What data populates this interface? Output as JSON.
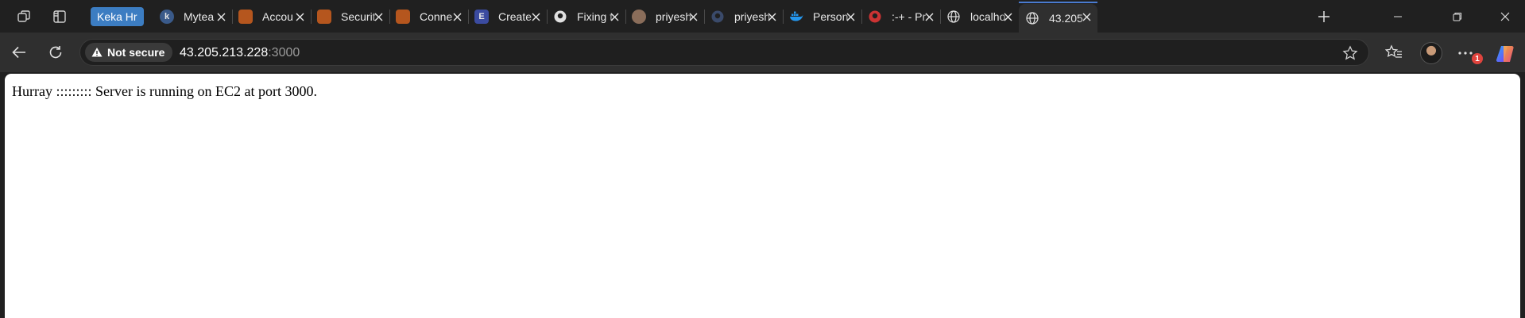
{
  "browser": {
    "tab_group_label": "Keka Hr",
    "tabs": [
      {
        "title": "Mytea",
        "icon": "keka-k-icon",
        "color": "#3a5a8a"
      },
      {
        "title": "Accou",
        "icon": "aws-cube-icon",
        "color": "#b5561e"
      },
      {
        "title": "Securit",
        "icon": "aws-ec2-icon",
        "color": "#b5561e"
      },
      {
        "title": "Conne",
        "icon": "aws-ec2-icon",
        "color": "#b5561e"
      },
      {
        "title": "Create",
        "icon": "doc-icon",
        "color": "#3b4ba0"
      },
      {
        "title": "Fixing t",
        "icon": "github-icon",
        "color": "#e0e0e0"
      },
      {
        "title": "priyesh",
        "icon": "profile-photo-icon",
        "color": "#8a6d5a"
      },
      {
        "title": "priyesh",
        "icon": "github-icon",
        "color": "#3a4a6a"
      },
      {
        "title": "Person",
        "icon": "docker-icon",
        "color": "#2496ed"
      },
      {
        "title": ":-+ - Pr",
        "icon": "github-error-icon",
        "color": "#cc3333"
      },
      {
        "title": "localho",
        "icon": "globe-icon",
        "color": "#e0e0e0"
      },
      {
        "title": "43.205",
        "icon": "globe-icon",
        "color": "#e0e0e0",
        "active": true
      }
    ]
  },
  "address_bar": {
    "security_label": "Not secure",
    "host": "43.205.213.228",
    "port": ":3000"
  },
  "notification_count": "1",
  "page": {
    "text": "Hurray ::::::::: Server is running on EC2 at port 3000."
  }
}
